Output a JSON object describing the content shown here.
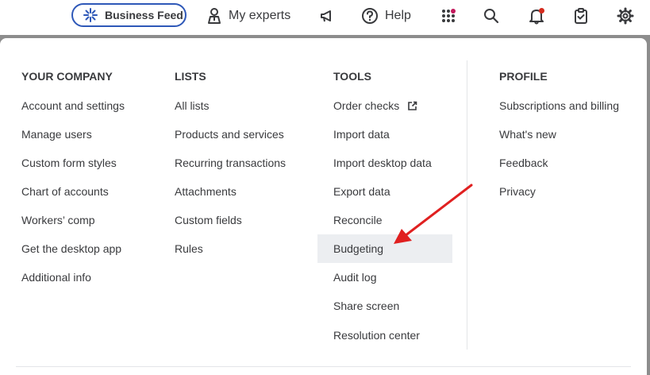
{
  "topbar": {
    "business_feed_label": "Business Feed",
    "my_experts_label": "My experts",
    "help_label": "Help"
  },
  "columns": {
    "company": {
      "title": "YOUR COMPANY",
      "items": [
        "Account and settings",
        "Manage users",
        "Custom form styles",
        "Chart of accounts",
        "Workers’ comp",
        "Get the desktop app",
        "Additional info"
      ]
    },
    "lists": {
      "title": "LISTS",
      "items": [
        "All lists",
        "Products and services",
        "Recurring transactions",
        "Attachments",
        "Custom fields",
        "Rules"
      ]
    },
    "tools": {
      "title": "TOOLS",
      "items": [
        "Order checks",
        "Import data",
        "Import desktop data",
        "Export data",
        "Reconcile",
        "Budgeting",
        "Audit log",
        "Share screen",
        "Resolution center"
      ]
    },
    "profile": {
      "title": "PROFILE",
      "items": [
        "Subscriptions and billing",
        "What's new",
        "Feedback",
        "Privacy"
      ]
    }
  },
  "highlighted_item": "Budgeting",
  "colors": {
    "accent": "#2e58b8",
    "highlight_bg": "#eceef1",
    "annotation_arrow": "#e02020",
    "notification_dot": "#d52b1e",
    "apps_dot": "#c2185b"
  }
}
